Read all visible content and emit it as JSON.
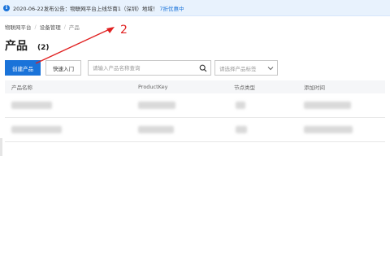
{
  "notice": {
    "text": "2020-06-22发布公告：物联网平台上线华南1（深圳）地域！",
    "discount": "7折优惠中"
  },
  "breadcrumb": [
    "物联网平台",
    "设备管理",
    "产品"
  ],
  "page": {
    "title": "产品",
    "count": "(2)"
  },
  "toolbar": {
    "create_label": "创建产品",
    "quickstart_label": "快速入门",
    "search_placeholder": "请输入产品名称查询",
    "tag_select_placeholder": "请选择产品标签"
  },
  "table": {
    "headers": [
      "产品名称",
      "ProductKey",
      "节点类型",
      "添加时间"
    ],
    "rows": [
      {
        "name": "",
        "key": "",
        "node_type": "",
        "added": ""
      },
      {
        "name": "",
        "key": "",
        "node_type": "",
        "added": ""
      }
    ]
  },
  "annotation": {
    "label": "2",
    "color": "#e02020"
  },
  "colors": {
    "primary": "#1a73d9",
    "notice_bg": "#e8f2fd"
  },
  "icons": {
    "info": "info-icon",
    "search": "search-icon",
    "chevron": "chevron-down-icon"
  }
}
